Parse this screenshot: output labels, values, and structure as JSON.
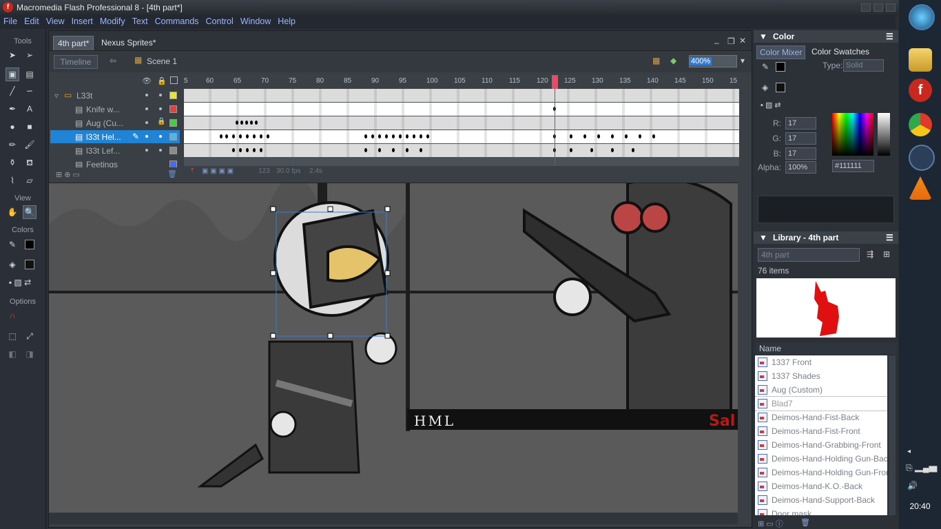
{
  "window": {
    "title": "Macromedia Flash Professional 8 - [4th part*]"
  },
  "menu": [
    "File",
    "Edit",
    "View",
    "Insert",
    "Modify",
    "Text",
    "Commands",
    "Control",
    "Window",
    "Help"
  ],
  "tools": {
    "label_tools": "Tools",
    "label_view": "View",
    "label_colors": "Colors",
    "label_options": "Options"
  },
  "document": {
    "tabs": [
      "4th part*",
      "Nexus Sprites*"
    ],
    "timeline_button": "Timeline",
    "scene": "Scene 1",
    "zoom": "400%"
  },
  "timeline": {
    "ruler": [
      "5",
      "60",
      "65",
      "70",
      "75",
      "80",
      "85",
      "90",
      "95",
      "100",
      "105",
      "110",
      "115",
      "120",
      "125",
      "130",
      "135",
      "140",
      "145",
      "150",
      "15"
    ],
    "layers": [
      {
        "name": "L33t",
        "color": "#e8e82a"
      },
      {
        "name": "Knife w...",
        "color": "#e84040"
      },
      {
        "name": "Aug (Cu...",
        "color": "#40d040"
      },
      {
        "name": "l33t Hel...",
        "color": "#4fb6e8"
      },
      {
        "name": "l33t Lef...",
        "color": "#8a8a8a"
      },
      {
        "name": "Feetings",
        "color": "#4a6ae8"
      }
    ],
    "status": {
      "frame": "123",
      "fps": "30.0 fps",
      "time": "2.4s"
    }
  },
  "stage": {
    "text": "HML",
    "corner_text": "Sal"
  },
  "color_panel": {
    "title": "Color",
    "tabs": [
      "Color Mixer",
      "Color Swatches"
    ],
    "type_label": "Type:",
    "type_value": "Solid",
    "r_label": "R:",
    "r": "17",
    "g_label": "G:",
    "g": "17",
    "b_label": "B:",
    "b": "17",
    "alpha_label": "Alpha:",
    "alpha": "100%",
    "hex": "#111111"
  },
  "library": {
    "title": "Library - 4th part",
    "source": "4th part",
    "count": "76 items",
    "name_header": "Name",
    "items": [
      "1337 Front",
      "1337 Shades",
      "Aug (Custom)",
      "Blad7",
      "Deimos-Hand-Fist-Back",
      "Deimos-Hand-Fist-Front",
      "Deimos-Hand-Grabbing-Front",
      "Deimos-Hand-Holding Gun-Back",
      "Deimos-Hand-Holding Gun-Front",
      "Deimos-Hand-K.O.-Back",
      "Deimos-Hand-Support-Back",
      "Door mask"
    ]
  },
  "taskbar": {
    "time": "20:40"
  },
  "colors": {
    "accent": "#1f84d6",
    "playhead": "#e0284a"
  }
}
